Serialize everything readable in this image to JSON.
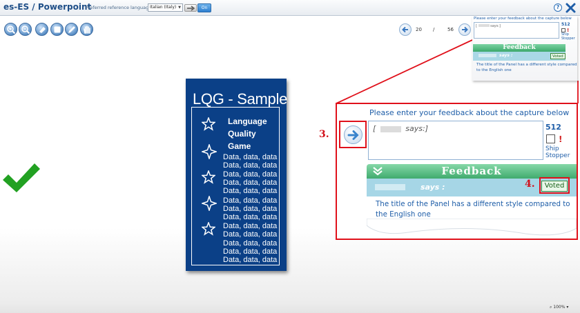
{
  "header": {
    "title": "es-ES / Powerpoint",
    "pref_label": "Preferred reference language",
    "language_value": "Italian (Italy)",
    "on_label": "On",
    "help_glyph": "?"
  },
  "toolbar": {
    "icons": [
      "zoom-in-icon",
      "zoom-out-icon",
      "eraser-icon",
      "rectangle-icon",
      "pen-icon",
      "hand-icon"
    ]
  },
  "navigation": {
    "current_page": "20",
    "separator": "/",
    "total_pages": "56"
  },
  "slide": {
    "title": "LQG - Sample",
    "heading_lines": [
      "Language",
      "Quality",
      "Game"
    ],
    "data_lines": [
      "Data, data, data",
      "Data, data, data",
      "Data, data, data",
      "Data, data, data",
      "Data, data, data",
      "Data, data, data",
      "Data, data, data",
      "Data, data, data",
      "Data, data, data",
      "Data, data, data",
      "Data, data, data",
      "Data, data, data",
      "Data, data, data"
    ]
  },
  "feedback": {
    "prompt": "Please enter your feedback about the capture below",
    "says_prefix": "[",
    "says_suffix": "says:]",
    "char_count": "512",
    "ship_stopper": "Ship Stopper",
    "exclamation": "!",
    "panel_title": "Feedback",
    "says_label": "says :",
    "voted_label": "Voted",
    "message": "The title of the Panel has a different style compared to the English one"
  },
  "callouts": {
    "step3": "3.",
    "step4": "4."
  },
  "status": {
    "zoom": "100%"
  },
  "colors": {
    "accent": "#1f5ea8",
    "slide_bg": "#0b4087",
    "feedback_green": "#40ab6e",
    "callout_red": "#e0101a",
    "check_green": "#22a122"
  }
}
